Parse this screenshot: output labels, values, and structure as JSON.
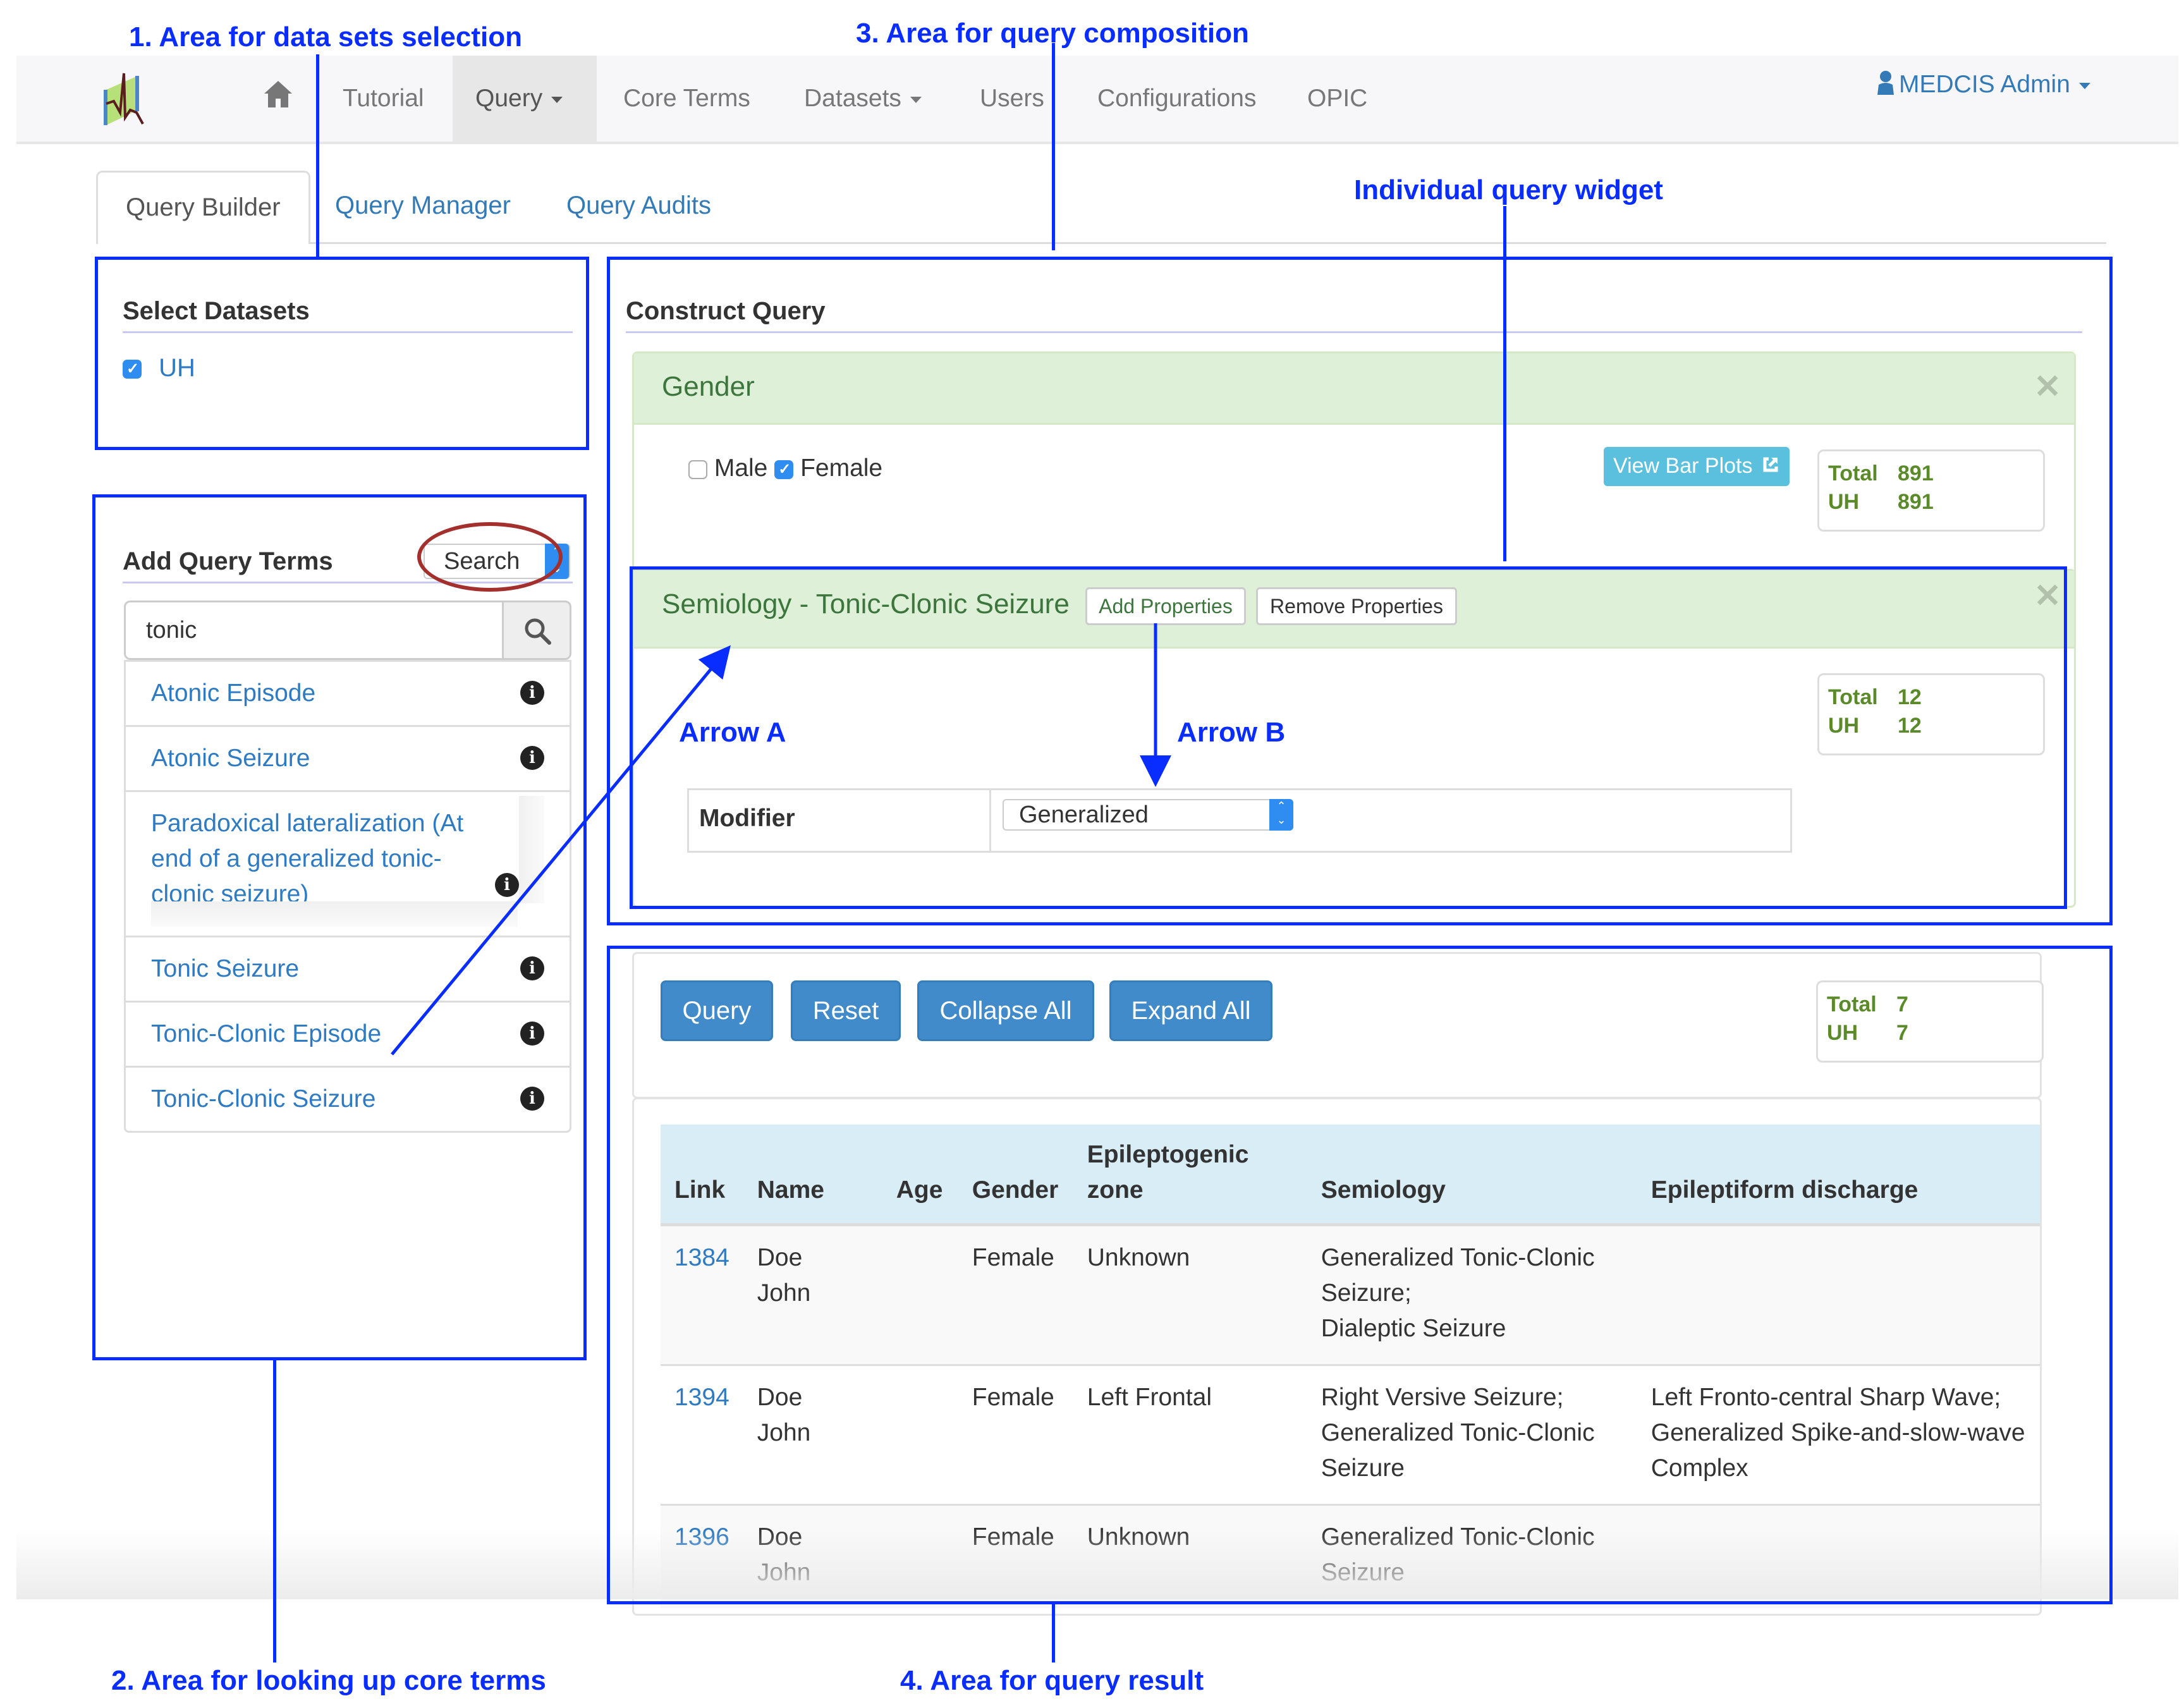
{
  "navbar": {
    "logo": "medcis-logo",
    "home_icon": "home-icon",
    "items": [
      {
        "label": "Tutorial",
        "active": false,
        "dropdown": false
      },
      {
        "label": "Query",
        "active": true,
        "dropdown": true
      },
      {
        "label": "Core Terms",
        "active": false,
        "dropdown": false
      },
      {
        "label": "Datasets",
        "active": false,
        "dropdown": true
      },
      {
        "label": "Users",
        "active": false,
        "dropdown": false
      },
      {
        "label": "Configurations",
        "active": false,
        "dropdown": false
      },
      {
        "label": "OPIC",
        "active": false,
        "dropdown": false
      }
    ],
    "user": {
      "label": "MEDCIS Admin",
      "icon": "user-icon"
    }
  },
  "tabs": [
    {
      "label": "Query Builder",
      "active": true
    },
    {
      "label": "Query Manager",
      "active": false
    },
    {
      "label": "Query Audits",
      "active": false
    }
  ],
  "datasets": {
    "heading": "Select Datasets",
    "items": [
      {
        "label": "UH",
        "checked": true
      }
    ]
  },
  "query_terms": {
    "heading": "Add Query Terms",
    "mode_select": "Search",
    "search_value": "tonic",
    "results": [
      "Atonic Episode",
      "Atonic Seizure",
      "Paradoxical lateralization (At end of a generalized tonic-clonic seizure)",
      "Tonic Seizure",
      "Tonic-Clonic Episode",
      "Tonic-Clonic Seizure"
    ]
  },
  "construct": {
    "heading": "Construct Query",
    "widgets": [
      {
        "title": "Gender",
        "options": [
          {
            "label": "Male",
            "checked": false
          },
          {
            "label": "Female",
            "checked": true
          }
        ],
        "view_bar_plots": "View Bar Plots",
        "counts": [
          {
            "k": "Total",
            "v": "891"
          },
          {
            "k": "UH",
            "v": "891"
          }
        ]
      },
      {
        "title": "Semiology - Tonic-Clonic Seizure",
        "add_properties": "Add Properties",
        "remove_properties": "Remove Properties",
        "counts": [
          {
            "k": "Total",
            "v": "12"
          },
          {
            "k": "UH",
            "v": "12"
          }
        ],
        "property": {
          "label": "Modifier",
          "value": "Generalized"
        }
      }
    ]
  },
  "actions": {
    "query": "Query",
    "reset": "Reset",
    "collapse_all": "Collapse All",
    "expand_all": "Expand All",
    "counts": [
      {
        "k": "Total",
        "v": "7"
      },
      {
        "k": "UH",
        "v": "7"
      }
    ]
  },
  "results": {
    "columns": [
      "Link",
      "Name",
      "Age",
      "Gender",
      "Epileptogenic zone",
      "Semiology",
      "Epileptiform discharge"
    ],
    "rows": [
      {
        "link": "1384",
        "name": [
          "Doe",
          "John"
        ],
        "age": "",
        "gender": "Female",
        "zone": "Unknown",
        "semiology": [
          "Generalized Tonic-Clonic Seizure;",
          "Dialeptic Seizure"
        ],
        "discharge": []
      },
      {
        "link": "1394",
        "name": [
          "Doe",
          "John"
        ],
        "age": "",
        "gender": "Female",
        "zone": "Left Frontal",
        "semiology": [
          "Right Versive Seizure;",
          "Generalized Tonic-Clonic Seizure"
        ],
        "discharge": [
          "Left Fronto-central Sharp Wave;",
          "Generalized Spike-and-slow-wave Complex"
        ]
      },
      {
        "link": "1396",
        "name": [
          "Doe",
          "John"
        ],
        "age": "",
        "gender": "Female",
        "zone": "Unknown",
        "semiology": [
          "Generalized Tonic-Clonic Seizure"
        ],
        "discharge": []
      }
    ]
  },
  "annotations": {
    "area1": "1. Area for data sets selection",
    "area2": "2. Area for looking up core terms",
    "area3": "3. Area for query composition",
    "area4": "4. Area for query result",
    "widget": "Individual query widget",
    "arrow_a": "Arrow A",
    "arrow_b": "Arrow B"
  },
  "colors": {
    "annotation": "#0a2dff",
    "link": "#2e7bc4",
    "widget_header": "#dff0d8",
    "widget_title": "#3c763d",
    "count_text": "#5a8a2a",
    "primary_button": "#428bca",
    "info_button": "#5bc0de",
    "table_header": "#d9edf7",
    "highlight_ellipse": "#a3302d"
  }
}
